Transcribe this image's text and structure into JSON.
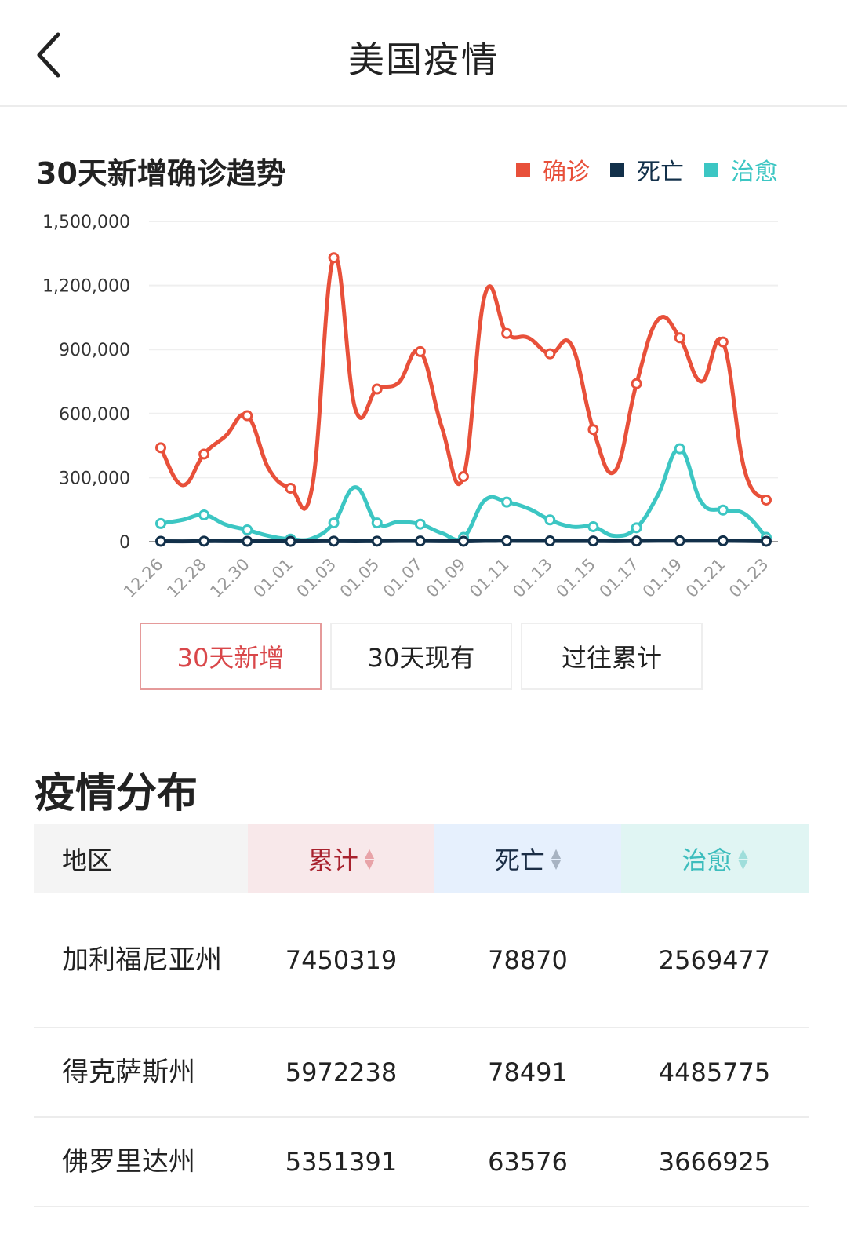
{
  "header": {
    "title": "美国疫情",
    "back_icon": "chevron-left-icon"
  },
  "chart_section": {
    "title": "30天新增确诊趋势",
    "legend": [
      {
        "label": "确诊",
        "color": "#e8503a"
      },
      {
        "label": "死亡",
        "color": "#12304a"
      },
      {
        "label": "治愈",
        "color": "#3cc6c3"
      }
    ],
    "tabs": [
      {
        "label": "30天新增",
        "active": true
      },
      {
        "label": "30天现有",
        "active": false
      },
      {
        "label": "过往累计",
        "active": false
      }
    ]
  },
  "chart_data": {
    "type": "line",
    "title": "30天新增确诊趋势",
    "xlabel": "",
    "ylabel": "",
    "ylim": [
      0,
      1500000
    ],
    "yticks": [
      0,
      300000,
      600000,
      900000,
      1200000,
      1500000
    ],
    "ytick_labels": [
      "0",
      "300,000",
      "600,000",
      "900,000",
      "1,200,000",
      "1,500,000"
    ],
    "grid": true,
    "legend_position": "top-right",
    "smooth": true,
    "x": [
      "12.26",
      "12.27",
      "12.28",
      "12.29",
      "12.30",
      "12.31",
      "01.01",
      "01.02",
      "01.03",
      "01.04",
      "01.05",
      "01.06",
      "01.07",
      "01.08",
      "01.09",
      "01.10",
      "01.11",
      "01.12",
      "01.13",
      "01.14",
      "01.15",
      "01.16",
      "01.17",
      "01.18",
      "01.19",
      "01.20",
      "01.21",
      "01.22",
      "01.23"
    ],
    "xtick_labels": [
      "12.26",
      "12.28",
      "12.30",
      "01.01",
      "01.03",
      "01.05",
      "01.07",
      "01.09",
      "01.11",
      "01.13",
      "01.15",
      "01.17",
      "01.19",
      "01.21",
      "01.23"
    ],
    "marker_every": 2,
    "series": [
      {
        "name": "确诊",
        "color": "#e8503a",
        "values": [
          440000,
          265000,
          410000,
          495000,
          590000,
          340000,
          250000,
          255000,
          1330000,
          620000,
          715000,
          745000,
          890000,
          535000,
          305000,
          1160000,
          975000,
          955000,
          880000,
          920000,
          525000,
          330000,
          740000,
          1040000,
          955000,
          750000,
          935000,
          335000,
          195000
        ]
      },
      {
        "name": "死亡",
        "color": "#12304a",
        "values": [
          2000,
          1500,
          2500,
          2500,
          2000,
          2000,
          1500,
          2000,
          2500,
          2000,
          2500,
          3000,
          3000,
          2500,
          2000,
          3500,
          4000,
          3500,
          3500,
          3000,
          3000,
          2500,
          3000,
          4000,
          4000,
          4000,
          4000,
          3000,
          2000
        ]
      },
      {
        "name": "治愈",
        "color": "#3cc6c3",
        "values": [
          85000,
          102000,
          125000,
          80000,
          55000,
          27000,
          12000,
          15000,
          88000,
          255000,
          88000,
          92000,
          82000,
          40000,
          20000,
          195000,
          185000,
          155000,
          102000,
          70000,
          70000,
          27000,
          65000,
          220000,
          435000,
          185000,
          148000,
          130000,
          20000
        ]
      }
    ]
  },
  "distribution": {
    "title": "疫情分布",
    "columns": [
      {
        "label": "地区"
      },
      {
        "label": "累计",
        "sort_icon": "sort-icon"
      },
      {
        "label": "死亡",
        "sort_icon": "sort-icon"
      },
      {
        "label": "治愈",
        "sort_icon": "sort-icon"
      }
    ],
    "rows": [
      {
        "region": "加利福尼亚州",
        "confirmed": "7450319",
        "deaths": "78870",
        "recovered": "2569477"
      },
      {
        "region": "得克萨斯州",
        "confirmed": "5972238",
        "deaths": "78491",
        "recovered": "4485775"
      },
      {
        "region": "佛罗里达州",
        "confirmed": "5351391",
        "deaths": "63576",
        "recovered": "3666925"
      }
    ]
  }
}
